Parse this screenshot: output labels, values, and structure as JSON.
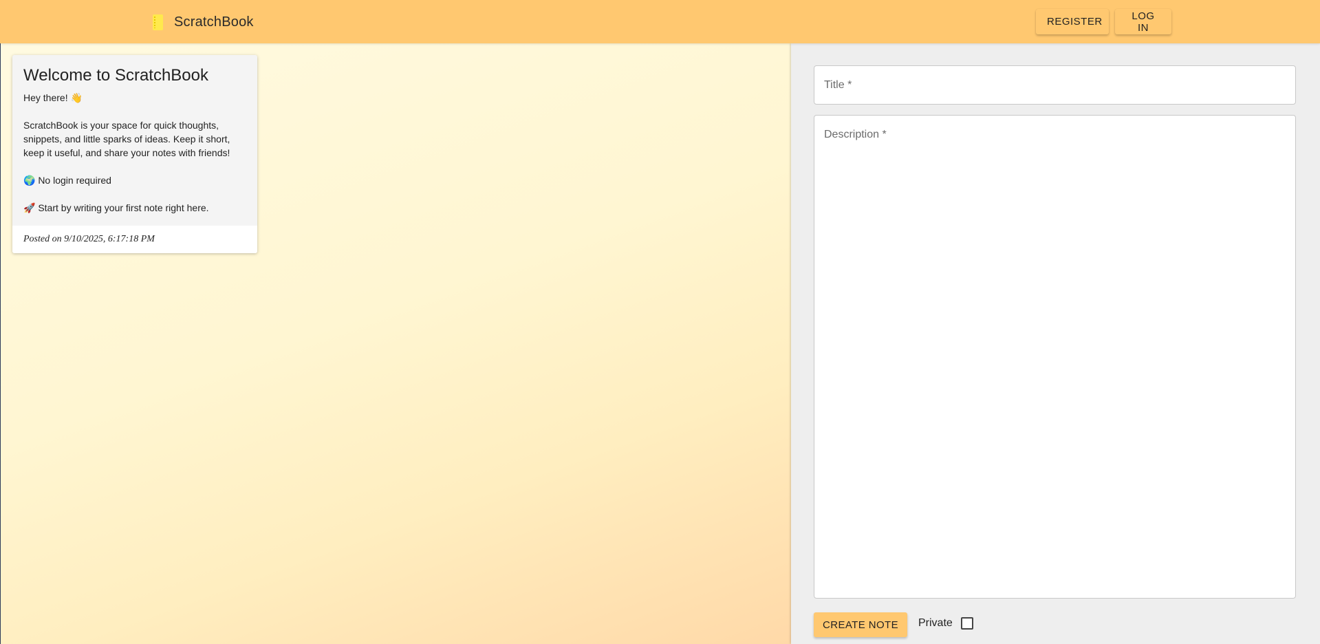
{
  "header": {
    "brand_icon": "notebook-icon",
    "brand_name": "ScratchBook",
    "register_label": "Register",
    "login_label": "Log in",
    "accent_color": "#ffc870"
  },
  "note": {
    "title": "Welcome to ScratchBook",
    "greeting": "Hey there! 👋",
    "intro": "ScratchBook is your space for quick thoughts, snippets, and little sparks of ideas. Keep it short, keep it useful, and share your notes with friends!",
    "feature": "🌍 No login required",
    "cta": "🚀 Start by writing your first note right here.",
    "posted": "Posted on 9/10/2025, 6:17:18 PM"
  },
  "form": {
    "title_label": "Title *",
    "title_value": "",
    "description_label": "Description *",
    "description_value": "",
    "create_label": "Create note",
    "private_label": "Private",
    "private_checked": false
  }
}
